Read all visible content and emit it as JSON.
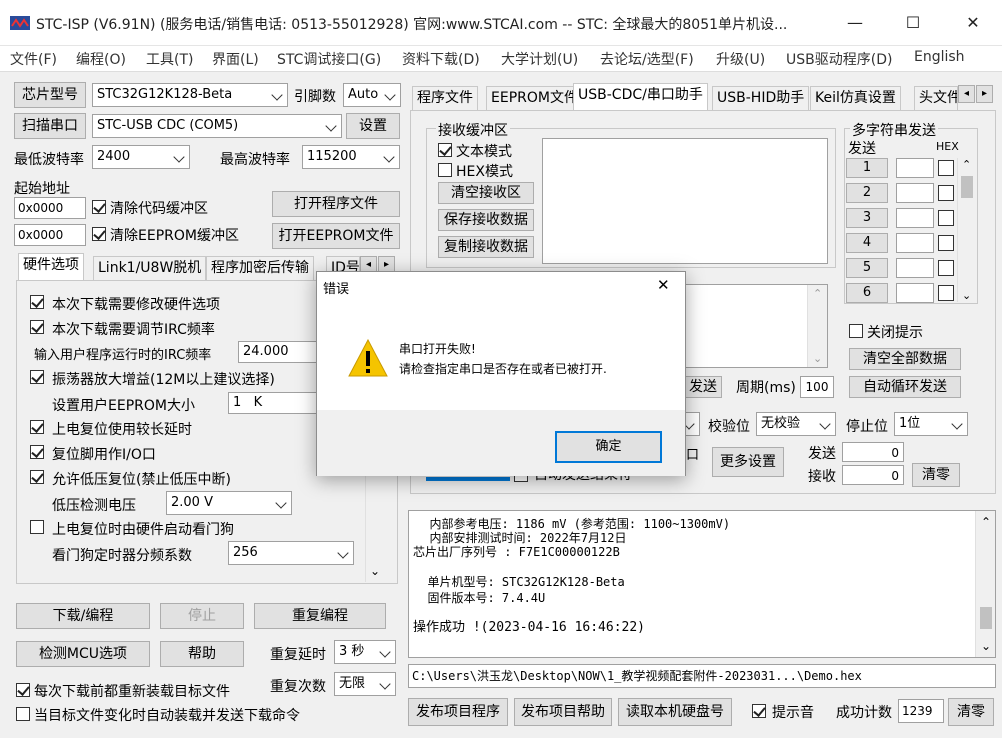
{
  "window": {
    "title": "STC-ISP (V6.91N) (服务电话/销售电话: 0513-55012928) 官网:www.STCAI.com  -- STC: 全球最大的8051单片机设...",
    "minimize": "—",
    "maximize": "☐",
    "close": "✕"
  },
  "menu": [
    "文件(F)",
    "编程(O)",
    "工具(T)",
    "界面(L)",
    "STC调试接口(G)",
    "资料下载(D)",
    "大学计划(U)",
    "去论坛/选型(F)",
    "升级(U)",
    "USB驱动程序(D)",
    "English"
  ],
  "left": {
    "chip_btn": "芯片型号",
    "chip_value": "STC32G12K128-Beta",
    "pins_label": "引脚数",
    "pins_value": "Auto",
    "scan_btn": "扫描串口",
    "port_value": "STC-USB CDC (COM5)",
    "settings_btn": "设置",
    "min_baud_label": "最低波特率",
    "min_baud": "2400",
    "max_baud_label": "最高波特率",
    "max_baud": "115200",
    "start_addr_label": "起始地址",
    "addr1": "0x0000",
    "clear_code": "清除代码缓冲区",
    "open_prog": "打开程序文件",
    "addr2": "0x0000",
    "clear_eeprom": "清除EEPROM缓冲区",
    "open_eeprom": "打开EEPROM文件",
    "tabs": [
      "硬件选项",
      "Link1/U8W脱机",
      "程序加密后传输",
      "ID号"
    ],
    "opts": {
      "o1": "本次下载需要修改硬件选项",
      "o2": "本次下载需要调节IRC频率",
      "irc_label": "输入用户程序运行时的IRC频率",
      "irc_value": "24.000",
      "o3": "振荡器放大增益(12M以上建议选择)",
      "eeprom_label": "设置用户EEPROM大小",
      "eeprom_value": "1   K",
      "o4": "上电复位使用较长延时",
      "o5": "复位脚用作I/O口",
      "o6": "允许低压复位(禁止低压中断)",
      "lv_label": "低压检测电压",
      "lv_value": "2.00 V",
      "o7": "上电复位时由硬件启动看门狗",
      "wd_label": "看门狗定时器分频系数",
      "wd_value": "256"
    },
    "download_btn": "下载/编程",
    "stop_btn": "停止",
    "reprog_btn": "重复编程",
    "detect_btn": "检测MCU选项",
    "help_btn": "帮助",
    "delay_label": "重复延时",
    "delay_value": "3 秒",
    "count_label": "重复次数",
    "count_value": "无限",
    "reload_each": "每次下载前都重新装载目标文件",
    "auto_reload": "当目标文件变化时自动装载并发送下载命令"
  },
  "right": {
    "tabs": [
      "程序文件",
      "EEPROM文件",
      "USB-CDC/串口助手",
      "USB-HID助手",
      "Keil仿真设置",
      "头文件"
    ],
    "recv_title": "接收缓冲区",
    "text_mode": "文本模式",
    "hex_mode": "HEX模式",
    "clear_recv": "清空接收区",
    "save_recv": "保存接收数据",
    "copy_recv": "复制接收数据",
    "multi_title": "多字符串发送",
    "send_col": "发送",
    "hex_col": "HEX",
    "multi_rows": [
      "1",
      "2",
      "3",
      "4",
      "5",
      "6"
    ],
    "close_hint": "关闭提示",
    "clear_all": "清空全部数据",
    "auto_loop": "自动循环发送",
    "send_btn": "发送",
    "period_label": "周期(ms)",
    "period_value": "100",
    "parity_label": "校验位",
    "parity_value": "无校验",
    "stop_label": "停止位",
    "stop_value": "1位",
    "more_settings": "更多设置",
    "sent_label": "发送",
    "sent_value": "0",
    "recv_label": "接收",
    "recv_value": "0",
    "clear_zero": "清零",
    "partial_label": "自动发送结束符"
  },
  "log": {
    "l1": "  内部参考电压: 1186 mV (参考范围: 1100~1300mV)",
    "l2": "  内部安排测试时间: 2022年7月12日",
    "l3": "芯片出厂序列号 : F7E1C00000122B",
    "l4": "  单片机型号: STC32G12K128-Beta",
    "l5": "  固件版本号: 7.4.4U",
    "l6": "操作成功 !(2023-04-16 16:46:22)"
  },
  "path": "C:\\Users\\洪玉龙\\Desktop\\NOW\\1_教学视频配套附件-2023031...\\Demo.hex",
  "bottom": {
    "publish_prog": "发布项目程序",
    "publish_help": "发布项目帮助",
    "read_disk": "读取本机硬盘号",
    "beep": "提示音",
    "success_label": "成功计数",
    "success_value": "1239",
    "clear": "清零"
  },
  "dialog": {
    "title": "错误",
    "line1": "串口打开失败!",
    "line2": "请检查指定串口是否存在或者已被打开.",
    "ok": "确定",
    "icon": "warning-icon",
    "close": "✕"
  },
  "colors": {
    "accent": "#0078d7",
    "warning": "#f5c400"
  }
}
